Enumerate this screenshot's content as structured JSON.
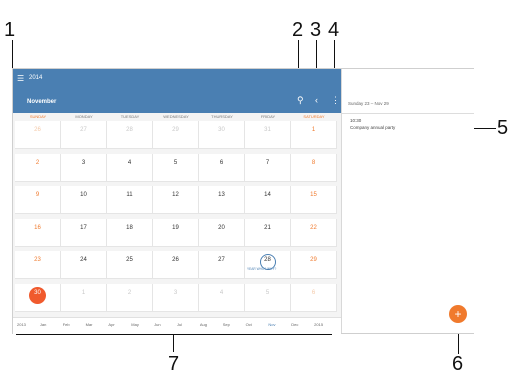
{
  "callouts": [
    "1",
    "2",
    "3",
    "4",
    "5",
    "6",
    "7"
  ],
  "appbar": {
    "year": "2014",
    "month": "November",
    "menu_icon": "hamburger-icon",
    "search_icon": "search-icon",
    "prev_icon": "chevron-left-icon",
    "more_icon": "more-vert-icon"
  },
  "days": [
    "SUNDAY",
    "MONDAY",
    "TUESDAY",
    "WEDNESDAY",
    "THURSDAY",
    "FRIDAY",
    "SATURDAY"
  ],
  "weeks": [
    [
      "26",
      "27",
      "28",
      "29",
      "30",
      "31",
      "1"
    ],
    [
      "2",
      "3",
      "4",
      "5",
      "6",
      "7",
      "8"
    ],
    [
      "9",
      "10",
      "11",
      "12",
      "13",
      "14",
      "15"
    ],
    [
      "16",
      "17",
      "18",
      "19",
      "20",
      "21",
      "22"
    ],
    [
      "23",
      "24",
      "25",
      "26",
      "27",
      "28",
      "29"
    ],
    [
      "30",
      "1",
      "2",
      "3",
      "4",
      "5",
      "6"
    ]
  ],
  "event_label": "YEAR WHO? WHY?",
  "sidepanel": {
    "range": "Sunday 23 – Nov 29",
    "event_time": "10:30",
    "event_title": "Company annual party",
    "fab": "+"
  },
  "months": [
    "2013",
    "Jan",
    "Feb",
    "Mar",
    "Apr",
    "May",
    "Jun",
    "Jul",
    "Aug",
    "Sep",
    "Oct",
    "Nov",
    "Dec",
    "2015"
  ]
}
